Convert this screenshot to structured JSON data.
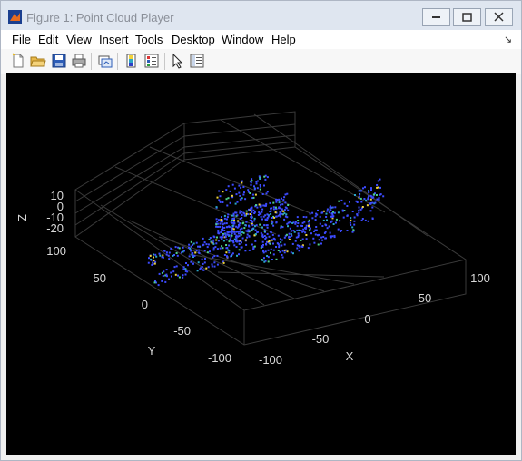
{
  "window": {
    "title": "Figure 1: Point Cloud Player"
  },
  "menu": {
    "items": [
      "File",
      "Edit",
      "View",
      "Insert",
      "Tools",
      "Desktop",
      "Window",
      "Help"
    ],
    "dock_arrow": "↘"
  },
  "axes": {
    "x_label": "X",
    "y_label": "Y",
    "z_label": "Z",
    "x_ticks": [
      "-100",
      "-50",
      "0",
      "50",
      "100"
    ],
    "y_ticks": [
      "100",
      "50",
      "0",
      "-50",
      "-100"
    ],
    "z_ticks": [
      "10",
      "0",
      "-10",
      "-20"
    ]
  },
  "colors": {
    "figure_bg": "#000000",
    "axis_text": "#d8d8d8",
    "grid": "#3a3a3a",
    "points_primary": "#3c4bff",
    "points_accent": [
      "#2aa6c7",
      "#4fd08a",
      "#f0d43a"
    ]
  },
  "icons": {
    "toolbar": [
      "new-figure-icon",
      "open-file-icon",
      "save-icon",
      "print-icon",
      "link-plot-icon",
      "insert-colorbar-icon",
      "insert-legend-icon",
      "edit-plot-arrow-icon",
      "property-inspector-icon"
    ]
  }
}
